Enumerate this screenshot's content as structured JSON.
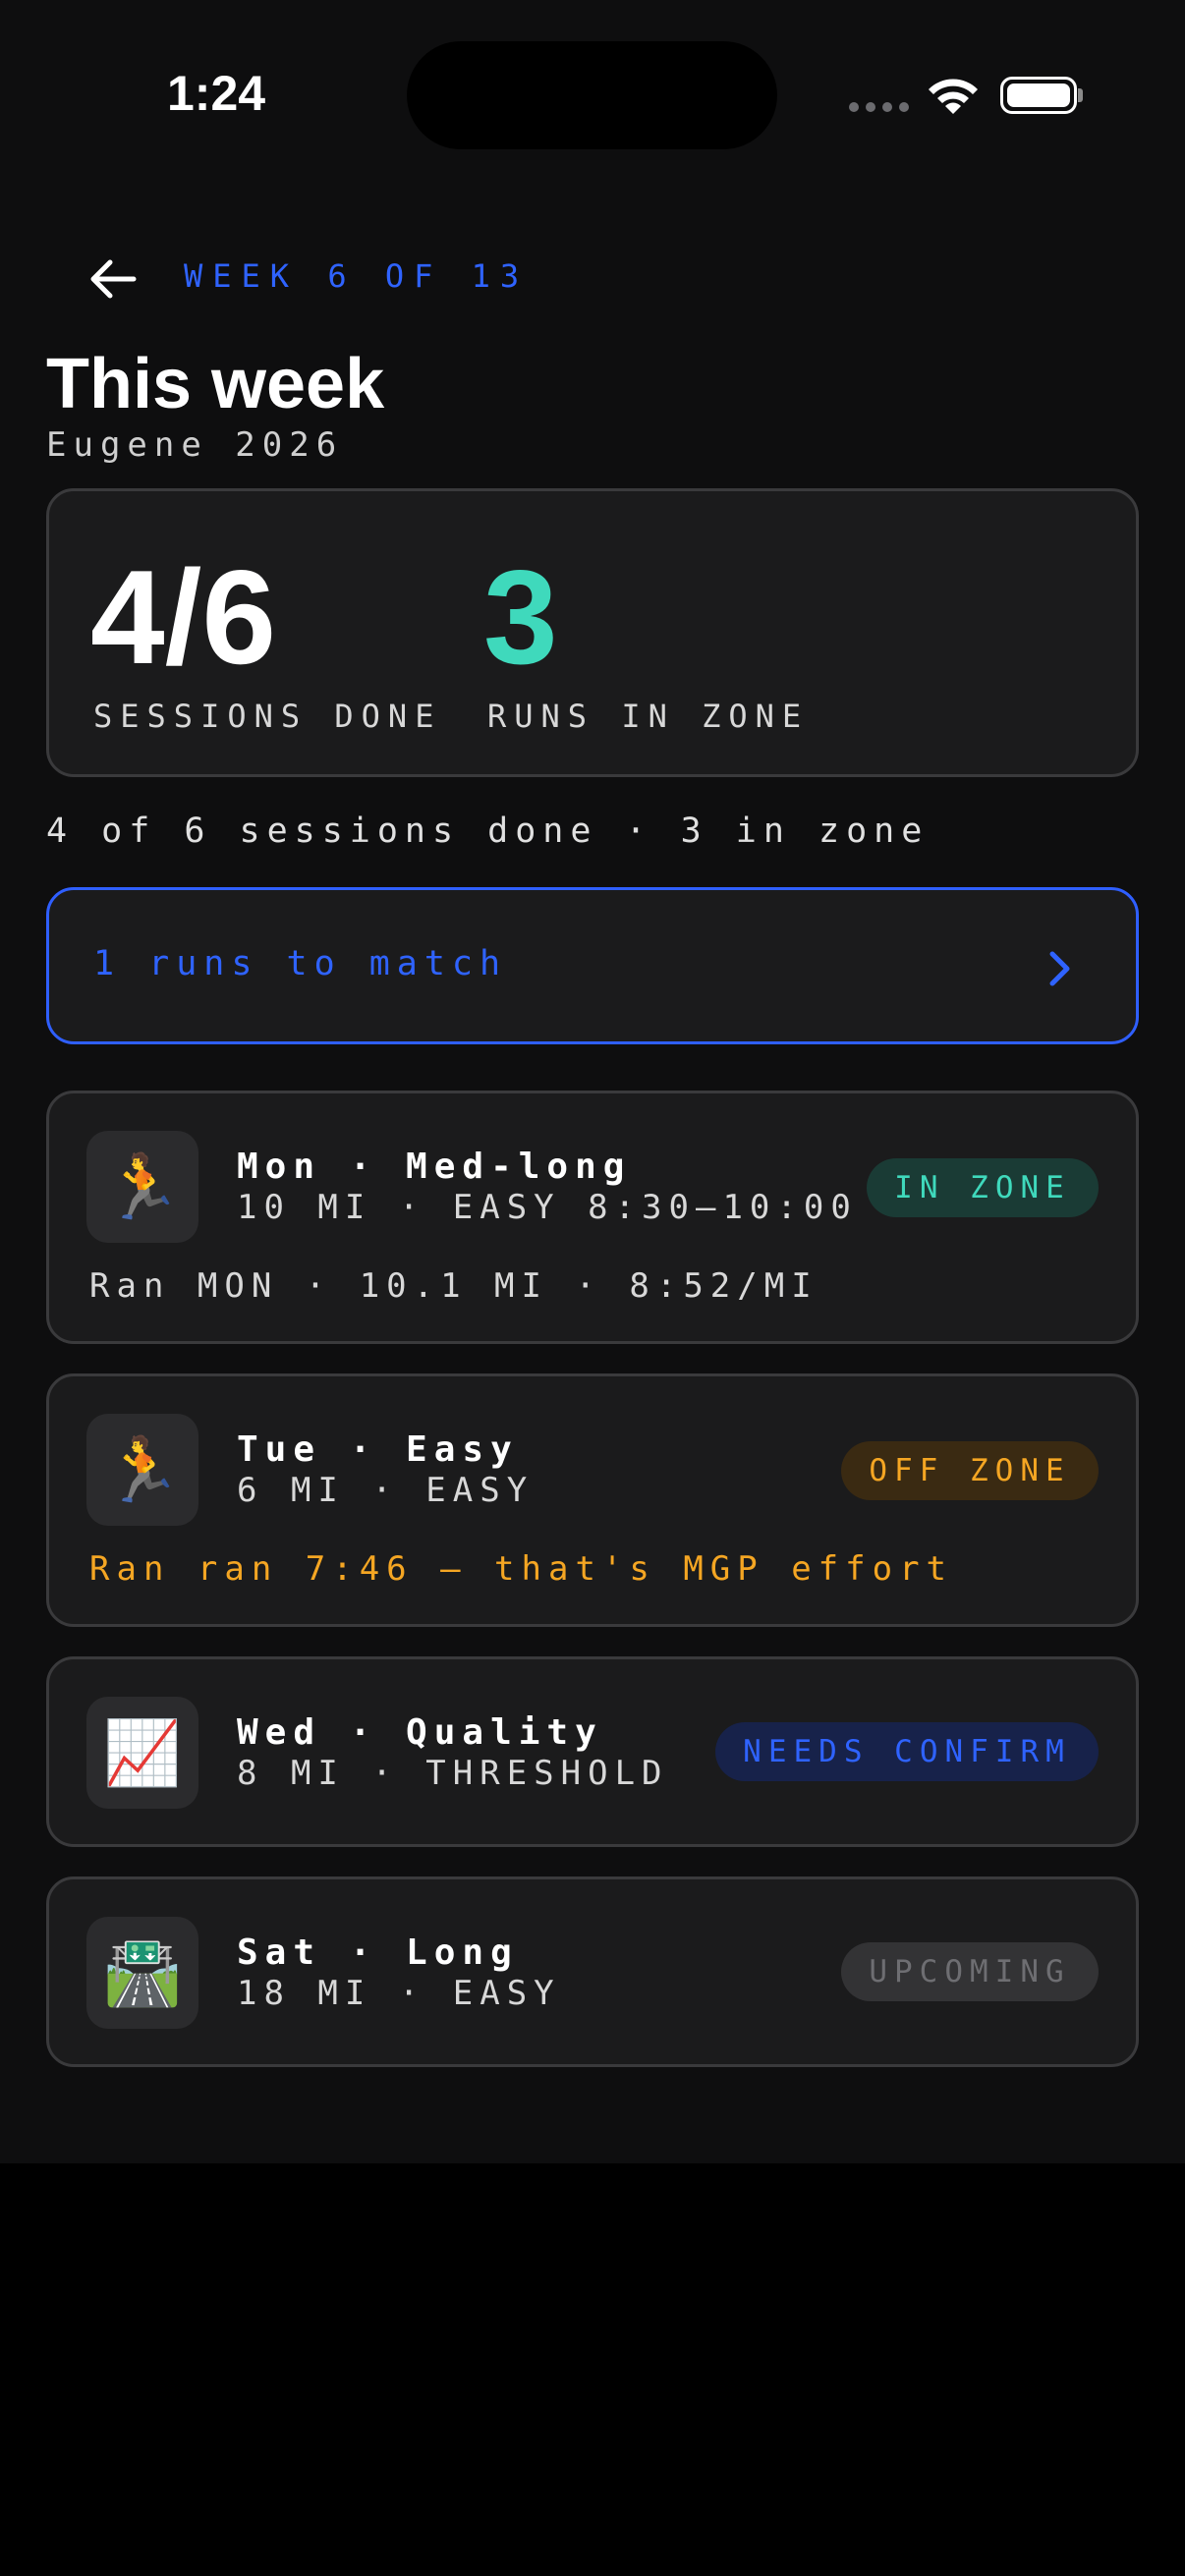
{
  "status_bar": {
    "time": "1:24"
  },
  "header": {
    "week_label": "WEEK 6 OF 13",
    "title": "This week",
    "subtitle": "Eugene 2026"
  },
  "stats": {
    "sessions_done": "4/6",
    "sessions_done_label": "SESSIONS DONE",
    "runs_in_zone": "3",
    "runs_in_zone_label": "RUNS IN ZONE"
  },
  "summary": "4 of 6 sessions done · 3 in zone",
  "match_button": {
    "label": "1 runs to match"
  },
  "colors": {
    "accent_blue": "#2f63ff",
    "zone_green": "#3fd9bc",
    "off_zone_orange": "#f5a623",
    "background": "#0e0e0f",
    "card": "#1b1b1c"
  },
  "sessions": [
    {
      "icon": "runner-icon",
      "title": "Mon · Med-long",
      "subtitle": "10 MI · EASY 8:30–10:00",
      "badge": "IN ZONE",
      "note": "Ran MON · 10.1 MI · 8:52/MI"
    },
    {
      "icon": "runner-icon",
      "title": "Tue · Easy",
      "subtitle": "6 MI · EASY",
      "badge": "OFF ZONE",
      "note": "Ran ran 7:46 — that's MGP effort"
    },
    {
      "icon": "chart-increasing-icon",
      "title": "Wed · Quality",
      "subtitle": "8 MI · THRESHOLD",
      "badge": "NEEDS CONFIRM"
    },
    {
      "icon": "motorway-icon",
      "title": "Sat · Long",
      "subtitle": "18 MI · EASY",
      "badge": "UPCOMING"
    }
  ]
}
